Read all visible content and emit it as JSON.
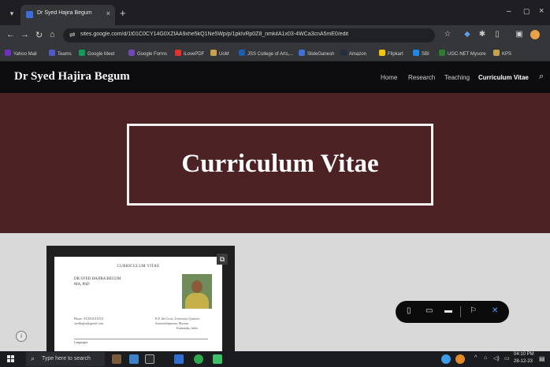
{
  "browser": {
    "tab_title": "Dr Syed Hajira Begum",
    "new_tab": "+",
    "tab_close": "×",
    "url": "sites.google.com/d/1t01C0CY14G0XZlAA9xhe5kQ1Ne5Wp/p/1pkIvRp0Z8_nmkiIA1x03-4WCa3cnA5mE0/edit",
    "window": {
      "minimize": "–",
      "maximize": "▢",
      "close": "×"
    }
  },
  "bookmarks": [
    {
      "label": "Yahoo Mail",
      "color": "#6f2fbf"
    },
    {
      "label": "Teams",
      "color": "#5059c9"
    },
    {
      "label": "Google Meet",
      "color": "#0f9d58"
    },
    {
      "label": "Google Forms",
      "color": "#7248b9"
    },
    {
      "label": "iLovePDF",
      "color": "#e5322d"
    },
    {
      "label": "UoM",
      "color": "#c8a24a"
    },
    {
      "label": "JSS College of Arts,...",
      "color": "#1a5fb4"
    },
    {
      "label": "SlideGanesh",
      "color": "#3f6fd8"
    },
    {
      "label": "Amazon",
      "color": "#232f3e"
    },
    {
      "label": "Flipkart",
      "color": "#f6c700"
    },
    {
      "label": "SBI",
      "color": "#1e88e5"
    },
    {
      "label": "UGC-NET Mysore",
      "color": "#2e7d32"
    },
    {
      "label": "KPS",
      "color": "#c8a24a"
    }
  ],
  "site": {
    "title": "Dr Syed Hajira Begum",
    "nav": [
      "Home",
      "Research",
      "Teaching",
      "Curriculum Vitae"
    ],
    "active_nav": "Curriculum Vitae",
    "hero_title": "Curriculum Vitae"
  },
  "cv_document": {
    "heading": "CURRICULUM VITAE",
    "name": "DR SYED HAJIRA BEGUM",
    "degree": "MA, PhD",
    "phone": "Phone: 9XXXXXXXX",
    "email": "syedhajira@gmail.com",
    "address_1": "B.P. 4th Cross, University Quarters",
    "address_2": "Saraswathipuram, Mysuru",
    "address_3": "Karnataka, India",
    "section": "Languages"
  },
  "taskbar": {
    "search_placeholder": "Type here to search",
    "time": "04:10 PM",
    "date": "28-12-23"
  },
  "colors": {
    "hero_background": "#4c2224",
    "site_header": "#0d0d0f",
    "content_background": "#d9d9d9"
  }
}
